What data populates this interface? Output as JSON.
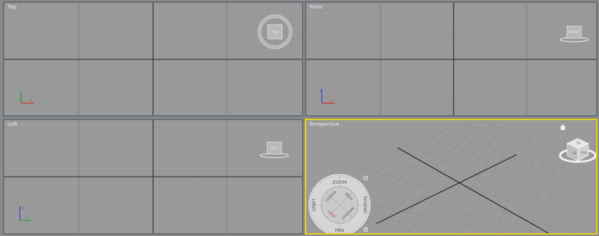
{
  "viewports": {
    "top": {
      "label": "Top",
      "cube_label": "TOP"
    },
    "front": {
      "label": "Front",
      "cube_label": "FRONT"
    },
    "left": {
      "label": "Left",
      "cube_label": "LEFT"
    },
    "perspective": {
      "label": "Perspective"
    }
  },
  "steering_wheel": {
    "zoom": "ZOOM",
    "orbit": "ORBIT",
    "rewind": "REWIND",
    "pan": "PAN",
    "center": "CENTER",
    "walk": "WALK",
    "look": "LOOK",
    "up_down": "UP/DOWN"
  },
  "colors": {
    "active_border": "#e6d21b",
    "inactive_border": "#676f78",
    "viewport_bg": "#9a9a9a",
    "grid_line": "#8f8f8f",
    "grid_major": "#262626",
    "axis_x": "#d0312d",
    "axis_y": "#27a33a",
    "axis_z": "#2e3fcf"
  }
}
